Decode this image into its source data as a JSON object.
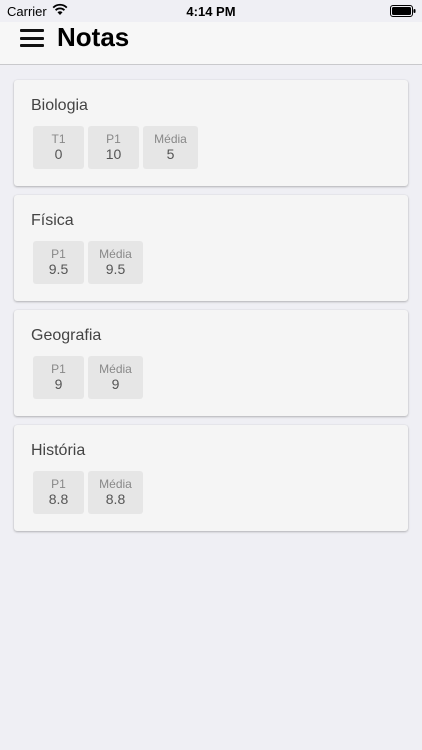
{
  "status_bar": {
    "carrier": "Carrier",
    "time": "4:14 PM"
  },
  "header": {
    "title": "Notas"
  },
  "subjects": [
    {
      "name": "Biologia",
      "grades": [
        {
          "label": "T1",
          "value": "0"
        },
        {
          "label": "P1",
          "value": "10"
        },
        {
          "label": "Média",
          "value": "5"
        }
      ]
    },
    {
      "name": "Física",
      "grades": [
        {
          "label": "P1",
          "value": "9.5"
        },
        {
          "label": "Média",
          "value": "9.5"
        }
      ]
    },
    {
      "name": "Geografia",
      "grades": [
        {
          "label": "P1",
          "value": "9"
        },
        {
          "label": "Média",
          "value": "9"
        }
      ]
    },
    {
      "name": "História",
      "grades": [
        {
          "label": "P1",
          "value": "8.8"
        },
        {
          "label": "Média",
          "value": "8.8"
        }
      ]
    }
  ]
}
